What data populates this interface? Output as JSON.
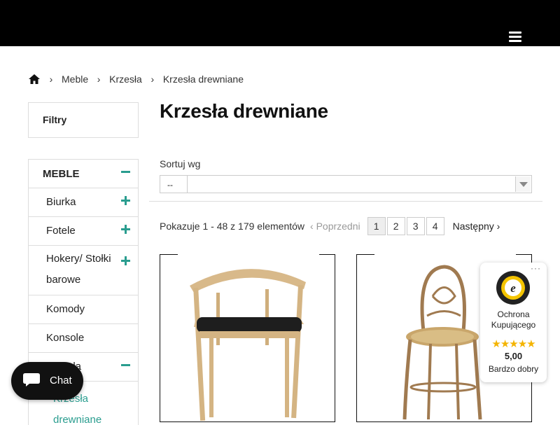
{
  "header": {
    "menu_icon": "hamburger-icon"
  },
  "breadcrumb": {
    "home_icon": "home-icon",
    "items": [
      "Meble",
      "Krzesła",
      "Krzesła drewniane"
    ]
  },
  "filters": {
    "title": "Filtry"
  },
  "categories": {
    "main": "MEBLE",
    "items": [
      {
        "label": "Biurka",
        "toggle": "plus"
      },
      {
        "label": "Fotele",
        "toggle": "plus"
      },
      {
        "label": "Hokery/ Stołki barowe",
        "toggle": "plus"
      },
      {
        "label": "Komody",
        "toggle": ""
      },
      {
        "label": "Konsole",
        "toggle": ""
      },
      {
        "label": "Krzesła",
        "toggle": "minus"
      }
    ],
    "active_sub": "Krzesła drewniane"
  },
  "page": {
    "title": "Krzesła drewniane"
  },
  "sort": {
    "label": "Sortuj wg",
    "value": "--"
  },
  "pagination": {
    "showing": "Pokazuje 1 - 48 z 179 elementów",
    "prev": "Poprzedni",
    "pages": [
      "1",
      "2",
      "3",
      "4"
    ],
    "current": "1",
    "next": "Następny"
  },
  "products": [
    {
      "name": "armchair-natural-wood-black-seat"
    },
    {
      "name": "bentwood-chair-rattan-seat"
    }
  ],
  "chat": {
    "label": "Chat",
    "icon": "chat-bubble-icon"
  },
  "trust_badge": {
    "seal_icon": "trusted-shops-seal-icon",
    "title": "Ochrona Kupującego",
    "stars": "★★★★★",
    "rating": "5,00",
    "rating_text": "Bardzo dobry",
    "menu": "···"
  },
  "colors": {
    "accent": "#2a9d8f",
    "header_bg": "#000000",
    "star": "#f4b400"
  }
}
